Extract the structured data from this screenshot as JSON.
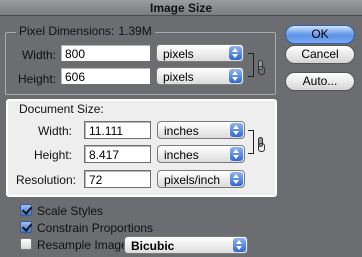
{
  "window": {
    "title": "Image Size"
  },
  "pixel_dimensions": {
    "legend": "Pixel Dimensions:",
    "size": "1.39M",
    "width": {
      "label": "Width:",
      "value": "800",
      "unit": "pixels"
    },
    "height": {
      "label": "Height:",
      "value": "606",
      "unit": "pixels"
    },
    "constrain_link_icon": "chain-link-icon"
  },
  "document_size": {
    "legend": "Document Size:",
    "width": {
      "label": "Width:",
      "value": "11.111",
      "unit": "inches"
    },
    "height": {
      "label": "Height:",
      "value": "8.417",
      "unit": "inches"
    },
    "resolution": {
      "label": "Resolution:",
      "value": "72",
      "unit": "pixels/inch"
    },
    "constrain_link_icon": "chain-link-icon"
  },
  "buttons": {
    "ok": "OK",
    "cancel": "Cancel",
    "auto": "Auto..."
  },
  "options": {
    "scale_styles": {
      "label": "Scale Styles",
      "checked": true
    },
    "constrain_proportions": {
      "label": "Constrain Proportions",
      "checked": true
    },
    "resample_image": {
      "label": "Resample Image:",
      "checked": false,
      "method": "Bicubic"
    }
  },
  "colors": {
    "panel_bg": "#6b6d70",
    "highlight_bg": "#eeeeee",
    "accent_blue": "#3a74d6"
  }
}
